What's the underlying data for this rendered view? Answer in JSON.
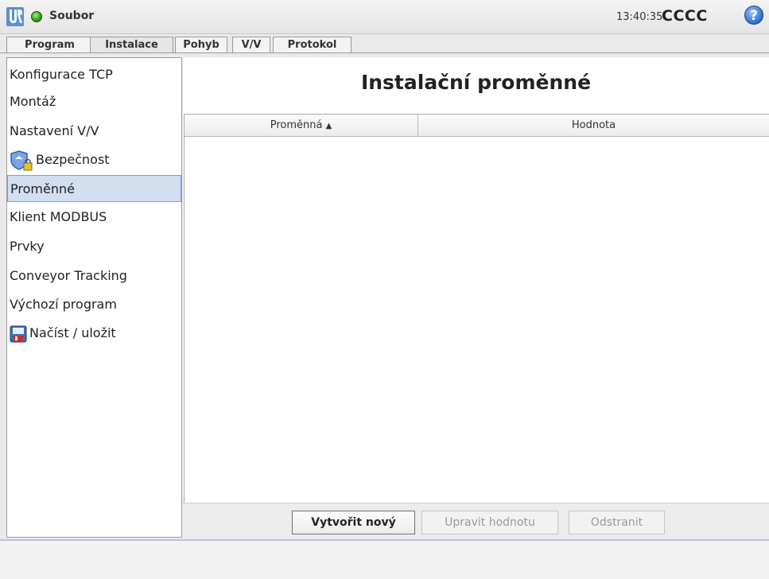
{
  "header": {
    "file_menu": "Soubor",
    "clock": "13:40:35",
    "robot_name": "CCCC",
    "help_symbol": "?",
    "colors": {
      "status": "#3aa11e",
      "help": "#3b76d6"
    }
  },
  "tabs": [
    {
      "label": "Program",
      "active": false
    },
    {
      "label": "Instalace",
      "active": true
    },
    {
      "label": "Pohyb",
      "active": false
    },
    {
      "label": "V/V",
      "active": false
    },
    {
      "label": "Protokol",
      "active": false
    }
  ],
  "sidebar": {
    "items": [
      {
        "label": "Konfigurace TCP"
      },
      {
        "label": "Montáž"
      },
      {
        "label": "Nastavení V/V"
      },
      {
        "label": "Bezpečnost",
        "icon": "shield-lock-icon"
      },
      {
        "label": "Proměnné",
        "selected": true
      },
      {
        "label": "Klient MODBUS"
      },
      {
        "label": "Prvky"
      },
      {
        "label": "Conveyor Tracking"
      },
      {
        "label": "Výchozí program"
      },
      {
        "label": "Načíst / uložit",
        "icon": "floppy-disk-icon"
      }
    ],
    "selected_color": "#d2def2"
  },
  "main": {
    "title": "Instalační proměnné",
    "table": {
      "columns": [
        "Proměnná",
        "Hodnota"
      ],
      "sort_indicator": "▲",
      "rows": []
    },
    "buttons": {
      "create": "Vytvořit nový",
      "edit": "Upravit hodnotu",
      "delete": "Odstranit"
    }
  }
}
